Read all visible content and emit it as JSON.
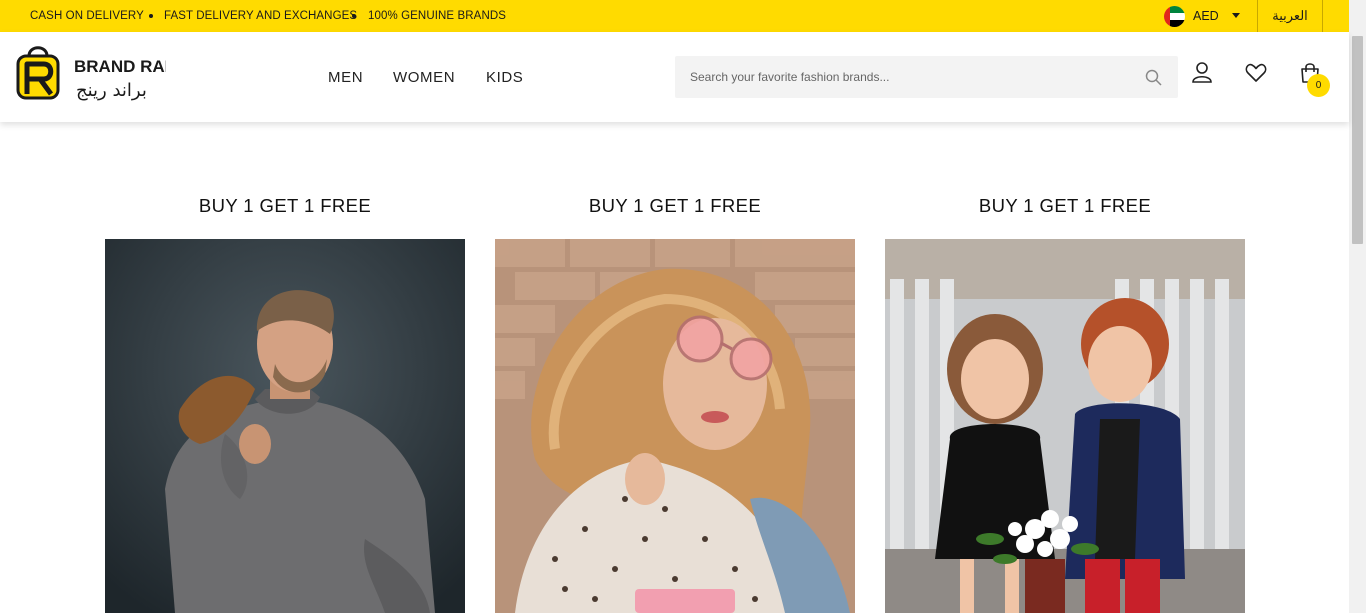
{
  "topbar": {
    "promos": [
      "CASH ON DELIVERY",
      "FAST DELIVERY AND EXCHANGES",
      "100% GENUINE BRANDS"
    ],
    "currency": "AED",
    "language": "العربية",
    "colors": {
      "background": "#ffdb00"
    }
  },
  "header": {
    "logo": {
      "text_en": "BRAND RANGE",
      "text_ar": "براند رينج"
    },
    "nav": [
      "MEN",
      "WOMEN",
      "KIDS"
    ],
    "search": {
      "placeholder": "Search your favorite fashion brands..."
    },
    "icons": [
      "search-icon",
      "user-icon",
      "heart-icon",
      "cart-icon"
    ],
    "cart_count": "0"
  },
  "promotions": [
    {
      "title": "BUY 1 GET 1 FREE",
      "category": "men"
    },
    {
      "title": "BUY 1 GET 1 FREE",
      "category": "women"
    },
    {
      "title": "BUY 1 GET 1 FREE",
      "category": "kids"
    }
  ],
  "colors": {
    "accent": "#ffdb00",
    "text": "#222222"
  }
}
